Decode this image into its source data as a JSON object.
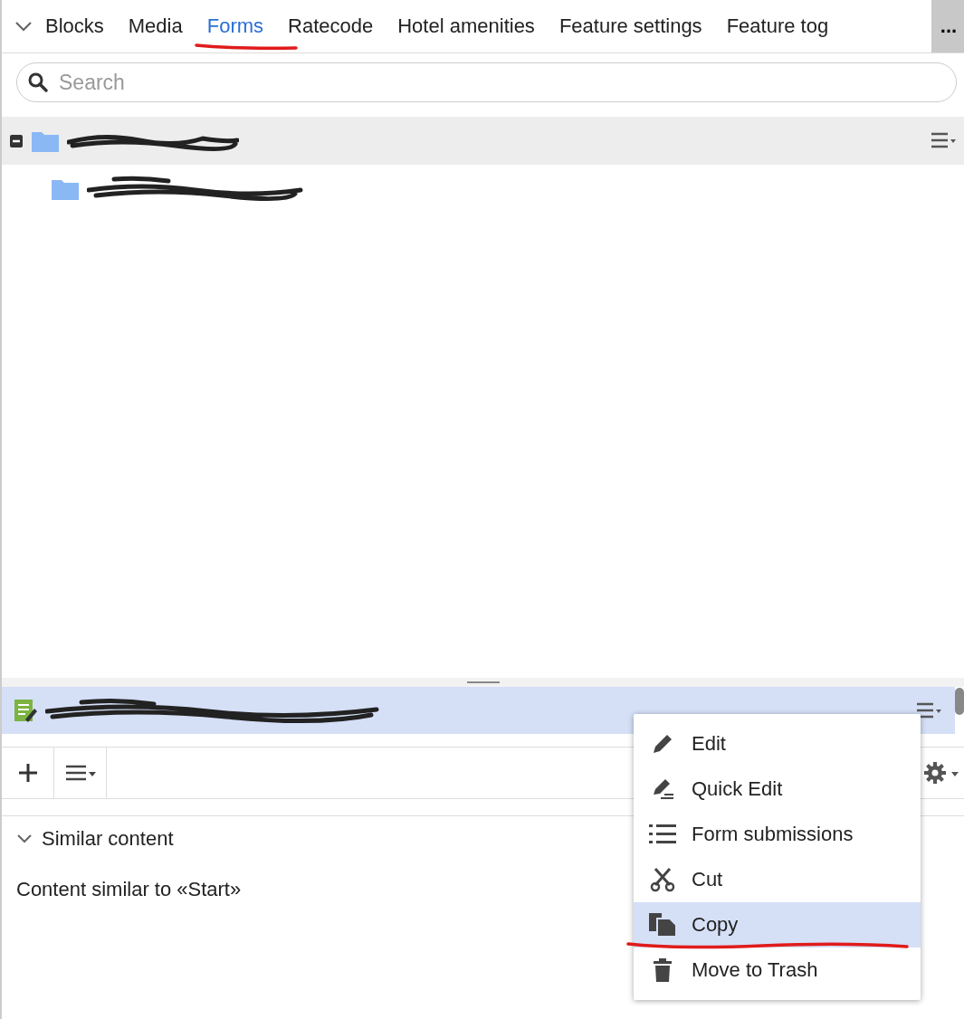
{
  "tabs": [
    {
      "label": "Blocks",
      "selected": false
    },
    {
      "label": "Media",
      "selected": false
    },
    {
      "label": "Forms",
      "selected": true
    },
    {
      "label": "Ratecode",
      "selected": false
    },
    {
      "label": "Hotel amenities",
      "selected": false
    },
    {
      "label": "Feature settings",
      "selected": false
    },
    {
      "label": "Feature tog",
      "selected": false
    }
  ],
  "overflow_button": "...",
  "search": {
    "placeholder": "Search"
  },
  "tree": [
    {
      "kind": "folder",
      "expanded": true,
      "selected": true,
      "children": [
        {
          "kind": "folder",
          "selected": false
        }
      ]
    }
  ],
  "selected_item": {
    "kind": "form"
  },
  "similar": {
    "title": "Similar content",
    "expanded": true,
    "text": "Content similar to «Start»"
  },
  "context_menu": [
    {
      "kind": "edit",
      "label": "Edit",
      "selected": false
    },
    {
      "kind": "quick-edit",
      "label": "Quick Edit",
      "selected": false
    },
    {
      "kind": "list",
      "label": "Form submissions",
      "selected": false
    },
    {
      "kind": "cut",
      "label": "Cut",
      "selected": false
    },
    {
      "kind": "copy",
      "label": "Copy",
      "selected": true
    },
    {
      "kind": "trash",
      "label": "Move to Trash",
      "selected": false
    }
  ]
}
